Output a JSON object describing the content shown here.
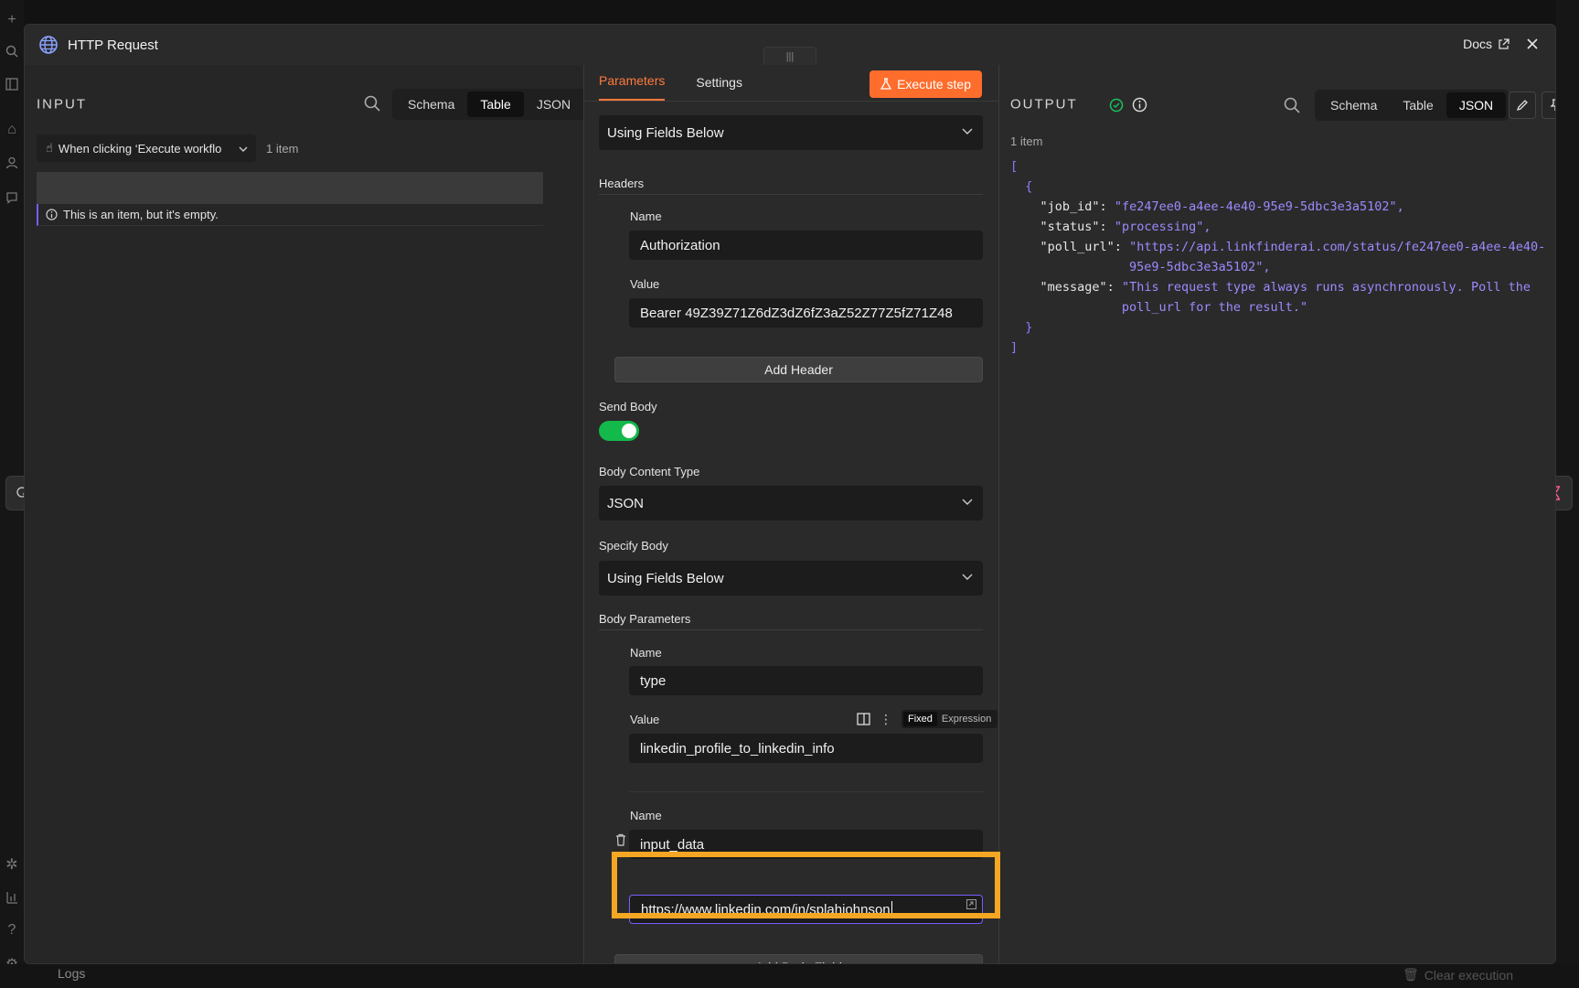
{
  "modal": {
    "title": "HTTP Request",
    "docs_label": "Docs"
  },
  "input": {
    "label": "INPUT",
    "views": [
      "Schema",
      "Table",
      "JSON"
    ],
    "active_view": "Table",
    "trigger": "When clicking ‘Execute workflo",
    "item_count": "1 item",
    "empty_message": "This is an item, but it's empty."
  },
  "params": {
    "tabs": [
      "Parameters",
      "Settings"
    ],
    "execute_label": "Execute step",
    "specify_headers_value": "Using Fields Below",
    "headers_title": "Headers",
    "header_name_label": "Name",
    "header_name_value": "Authorization",
    "header_value_label": "Value",
    "header_value_value": "Bearer 49Z39Z71Z6dZ3dZ6fZ3aZ52Z77Z5fZ71Z48",
    "add_header_label": "Add Header",
    "send_body_label": "Send Body",
    "body_content_type_label": "Body Content Type",
    "body_content_type_value": "JSON",
    "specify_body_label": "Specify Body",
    "specify_body_value": "Using Fields Below",
    "body_params_title": "Body Parameters",
    "body_param1_name_label": "Name",
    "body_param1_name_value": "type",
    "body_param1_value_label": "Value",
    "body_param1_value_value": "linkedin_profile_to_linkedin_info",
    "fixed_label": "Fixed",
    "expression_label": "Expression",
    "body_param2_name_label": "Name",
    "body_param2_name_value": "input_data",
    "body_param2_value_value": "https://www.linkedin.com/in/splahjohnson",
    "add_body_field_label": "Add Body Field"
  },
  "output": {
    "label": "OUTPUT",
    "views": [
      "Schema",
      "Table",
      "JSON"
    ],
    "active_view": "JSON",
    "item_count": "1 item",
    "json": {
      "job_id_key": "\"job_id\":",
      "job_id_val": "\"fe247ee0-a4ee-4e40-95e9-5dbc3e3a5102\",",
      "status_key": "\"status\":",
      "status_val": "\"processing\",",
      "poll_url_key": "\"poll_url\":",
      "poll_url_val1": "\"https://api.linkfinderai.com/status/fe247ee0-a4ee-4e40-",
      "poll_url_val2": "95e9-5dbc3e3a5102\",",
      "message_key": "\"message\":",
      "message_val1": "\"This request type always runs asynchronously. Poll the",
      "message_val2": "poll_url for the result.\""
    }
  },
  "footer": {
    "logs_label": "Logs",
    "clear_execution_label": "Clear execution"
  },
  "colors": {
    "accent": "#ff6d2d",
    "toggle_on": "#13b94a",
    "highlight": "#f5a623",
    "focus": "#7a5cff"
  }
}
